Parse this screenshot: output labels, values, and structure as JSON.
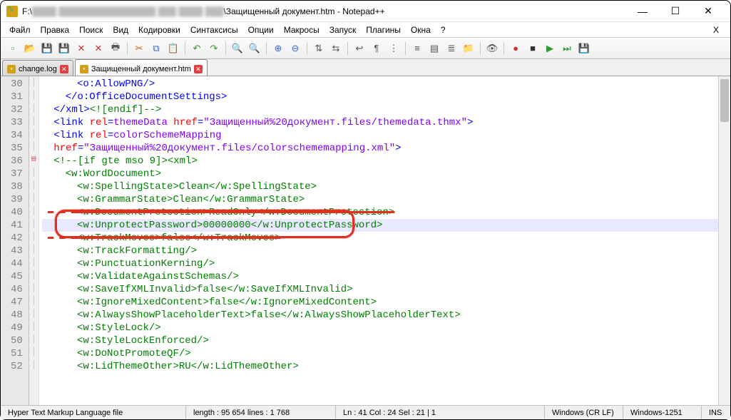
{
  "title": {
    "drive": "F:\\",
    "blurred": "████ ████████████████ ███ ████ ███",
    "suffix": "\\Защищенный документ.htm - Notepad++"
  },
  "menus": [
    "Файл",
    "Правка",
    "Поиск",
    "Вид",
    "Кодировки",
    "Синтаксисы",
    "Опции",
    "Макросы",
    "Запуск",
    "Плагины",
    "Окна",
    "?"
  ],
  "tabs": [
    {
      "label": "change.log",
      "active": false
    },
    {
      "label": "Защищенный документ.htm",
      "active": true
    }
  ],
  "lines": [
    {
      "n": 30,
      "indent": 3,
      "parts": [
        {
          "c": "t-tag",
          "t": "<o:AllowPNG/>"
        }
      ]
    },
    {
      "n": 31,
      "indent": 2,
      "parts": [
        {
          "c": "t-tag",
          "t": "</o:OfficeDocumentSettings>"
        }
      ]
    },
    {
      "n": 32,
      "indent": 1,
      "parts": [
        {
          "c": "t-tag",
          "t": "</xml>"
        },
        {
          "c": "t-cm",
          "t": "<![endif]-->"
        }
      ]
    },
    {
      "n": 33,
      "indent": 1,
      "parts": [
        {
          "c": "t-tag",
          "t": "<link "
        },
        {
          "c": "t-attr",
          "t": "rel"
        },
        {
          "c": "t-tag",
          "t": "="
        },
        {
          "c": "t-val",
          "t": "themeData"
        },
        {
          "c": "t-tag",
          "t": " "
        },
        {
          "c": "t-attr",
          "t": "href"
        },
        {
          "c": "t-tag",
          "t": "="
        },
        {
          "c": "t-val",
          "t": "\"Защищенный%20документ.files/themedata.thmx\""
        },
        {
          "c": "t-tag",
          "t": ">"
        }
      ]
    },
    {
      "n": 34,
      "indent": 1,
      "parts": [
        {
          "c": "t-tag",
          "t": "<link "
        },
        {
          "c": "t-attr",
          "t": "rel"
        },
        {
          "c": "t-tag",
          "t": "="
        },
        {
          "c": "t-val",
          "t": "colorSchemeMapping"
        }
      ]
    },
    {
      "n": 35,
      "indent": 1,
      "parts": [
        {
          "c": "t-attr",
          "t": "href"
        },
        {
          "c": "t-tag",
          "t": "="
        },
        {
          "c": "t-val",
          "t": "\"Защищенный%20документ.files/colorschememapping.xml\""
        },
        {
          "c": "t-tag",
          "t": ">"
        }
      ]
    },
    {
      "n": 36,
      "indent": 1,
      "fold": "-",
      "parts": [
        {
          "c": "t-cm",
          "t": "<!--[if gte mso 9]><xml>"
        }
      ]
    },
    {
      "n": 37,
      "indent": 2,
      "parts": [
        {
          "c": "t-cm",
          "t": "<w:WordDocument>"
        }
      ]
    },
    {
      "n": 38,
      "indent": 3,
      "parts": [
        {
          "c": "t-cm",
          "t": "<w:SpellingState>Clean</w:SpellingState>"
        }
      ]
    },
    {
      "n": 39,
      "indent": 3,
      "parts": [
        {
          "c": "t-cm",
          "t": "<w:GrammarState>Clean</w:GrammarState>"
        }
      ]
    },
    {
      "n": 40,
      "indent": 3,
      "parts": [
        {
          "c": "t-cm",
          "t": "<w:DocumentProtection>ReadOnly</w:DocumentProtection>"
        }
      ],
      "covered": true
    },
    {
      "n": 41,
      "indent": 3,
      "curr": true,
      "hl": true,
      "parts": [
        {
          "c": "t-cm",
          "t": "<w:UnprotectPassword>"
        },
        {
          "c": "t-cm sel",
          "t": "00000000"
        },
        {
          "c": "t-cm",
          "t": "</w:UnprotectPassword>"
        }
      ]
    },
    {
      "n": 42,
      "indent": 3,
      "parts": [
        {
          "c": "t-cm",
          "t": "<w:TrackMoves>false</w:TrackMoves>"
        }
      ],
      "covered": true
    },
    {
      "n": 43,
      "indent": 3,
      "parts": [
        {
          "c": "t-cm",
          "t": "<w:TrackFormatting/>"
        }
      ]
    },
    {
      "n": 44,
      "indent": 3,
      "parts": [
        {
          "c": "t-cm",
          "t": "<w:PunctuationKerning/>"
        }
      ]
    },
    {
      "n": 45,
      "indent": 3,
      "parts": [
        {
          "c": "t-cm",
          "t": "<w:ValidateAgainstSchemas/>"
        }
      ]
    },
    {
      "n": 46,
      "indent": 3,
      "parts": [
        {
          "c": "t-cm",
          "t": "<w:SaveIfXMLInvalid>false</w:SaveIfXMLInvalid>"
        }
      ]
    },
    {
      "n": 47,
      "indent": 3,
      "parts": [
        {
          "c": "t-cm",
          "t": "<w:IgnoreMixedContent>false</w:IgnoreMixedContent>"
        }
      ]
    },
    {
      "n": 48,
      "indent": 3,
      "parts": [
        {
          "c": "t-cm",
          "t": "<w:AlwaysShowPlaceholderText>false</w:AlwaysShowPlaceholderText>"
        }
      ]
    },
    {
      "n": 49,
      "indent": 3,
      "parts": [
        {
          "c": "t-cm",
          "t": "<w:StyleLock/>"
        }
      ]
    },
    {
      "n": 50,
      "indent": 3,
      "parts": [
        {
          "c": "t-cm",
          "t": "<w:StyleLockEnforced/>"
        }
      ]
    },
    {
      "n": 51,
      "indent": 3,
      "parts": [
        {
          "c": "t-cm",
          "t": "<w:DoNotPromoteQF/>"
        }
      ]
    },
    {
      "n": 52,
      "indent": 3,
      "parts": [
        {
          "c": "t-cm",
          "t": "<w:LidThemeOther>RU</w:LidThemeOther>"
        }
      ]
    }
  ],
  "toolbar_icons": [
    "new-icon",
    "open-icon",
    "save-icon",
    "save-all-icon",
    "close-icon",
    "close-all-icon",
    "print-icon",
    "|",
    "cut-icon",
    "copy-icon",
    "paste-icon",
    "|",
    "undo-icon",
    "redo-icon",
    "|",
    "find-icon",
    "replace-icon",
    "|",
    "zoom-in-icon",
    "zoom-out-icon",
    "|",
    "sync-v-icon",
    "sync-h-icon",
    "|",
    "wordwrap-icon",
    "all-chars-icon",
    "indent-guide-icon",
    "|",
    "lang-icon",
    "doc-map-icon",
    "func-list-icon",
    "folder-icon",
    "|",
    "monitor-icon",
    "|",
    "record-icon",
    "stop-icon",
    "play-icon",
    "play-multi-icon",
    "save-macro-icon"
  ],
  "icon_glyphs": {
    "new-icon": "▫",
    "open-icon": "📂",
    "save-icon": "💾",
    "save-all-icon": "💾",
    "close-icon": "✕",
    "close-all-icon": "✕",
    "print-icon": "🖶",
    "cut-icon": "✂",
    "copy-icon": "⧉",
    "paste-icon": "📋",
    "undo-icon": "↶",
    "redo-icon": "↷",
    "find-icon": "🔍",
    "replace-icon": "🔍",
    "zoom-in-icon": "⊕",
    "zoom-out-icon": "⊖",
    "sync-v-icon": "⇅",
    "sync-h-icon": "⇆",
    "wordwrap-icon": "↩",
    "all-chars-icon": "¶",
    "indent-guide-icon": "⋮",
    "lang-icon": "≡",
    "doc-map-icon": "▤",
    "func-list-icon": "≣",
    "folder-icon": "📁",
    "monitor-icon": "👁",
    "record-icon": "●",
    "stop-icon": "■",
    "play-icon": "▶",
    "play-multi-icon": "⏭",
    "save-macro-icon": "💾"
  },
  "status": {
    "filetype": "Hyper Text Markup Language file",
    "length": "length : 95 654    lines : 1 768",
    "pos": "Ln : 41    Col : 24    Sel : 21 | 1",
    "eol": "Windows (CR LF)",
    "enc": "Windows-1251",
    "mode": "INS"
  }
}
